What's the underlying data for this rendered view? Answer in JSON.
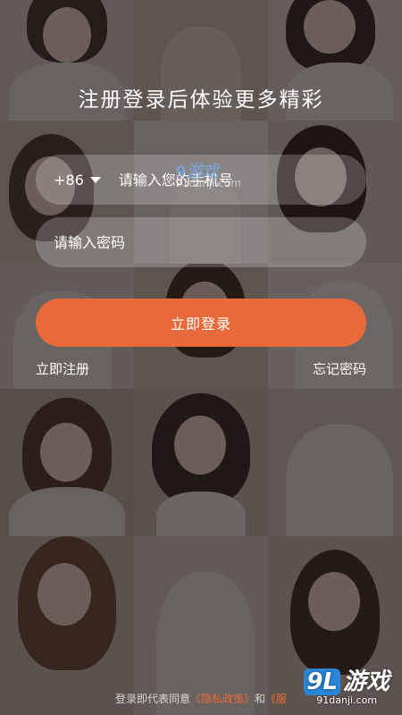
{
  "header": {
    "slogan": "注册登录后体验更多精彩"
  },
  "phone_field": {
    "country_code": "+86",
    "placeholder": "请输入您的手机号",
    "value": ""
  },
  "password_field": {
    "placeholder": "请输入密码",
    "value": ""
  },
  "actions": {
    "login_label": "立即登录",
    "register_label": "立即注册",
    "forgot_label": "忘记密码"
  },
  "footer": {
    "prefix": "登录即代表同意",
    "privacy_policy": "《隐私政策》",
    "connector": "和",
    "second_policy": "《服"
  },
  "watermark": {
    "center_logo": "9游戏",
    "center_url": "91danji.com",
    "corner_logo_num": "9L",
    "corner_logo_text": "游戏",
    "corner_url": "91danji.com"
  },
  "colors": {
    "accent": "#e8693a",
    "field_bg": "rgba(255,255,255,0.22)",
    "overlay": "rgba(25,20,18,0.62)"
  },
  "icons": {
    "country_dropdown": "caret-down-icon"
  }
}
